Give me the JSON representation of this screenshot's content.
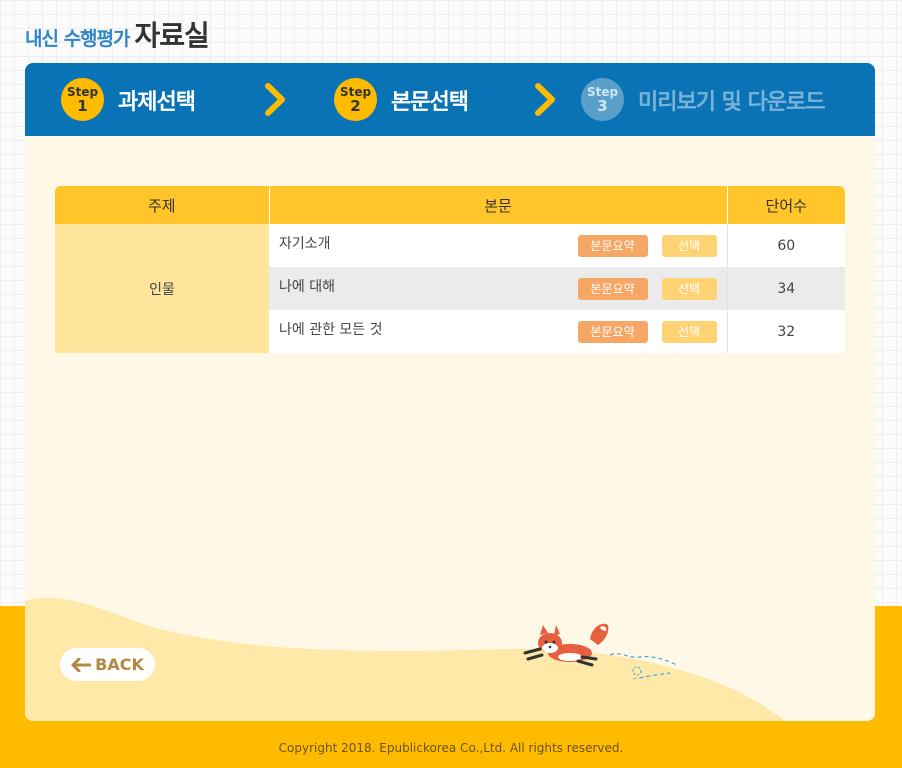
{
  "header": {
    "sub_title": "내신 수행평가",
    "main_title": "자료실"
  },
  "steps": [
    {
      "word": "Step",
      "number": "1",
      "label": "과제선택",
      "state": "done"
    },
    {
      "word": "Step",
      "number": "2",
      "label": "본문선택",
      "state": "active"
    },
    {
      "word": "Step",
      "number": "3",
      "label": "미리보기 및 다운로드",
      "state": "inactive"
    }
  ],
  "table": {
    "headers": [
      "주제",
      "본문",
      "단어수"
    ],
    "topic": "인물",
    "rows": [
      {
        "title": "자기소개",
        "summary_label": "본문요약",
        "select_label": "선택",
        "count": "60"
      },
      {
        "title": "나에 대해",
        "summary_label": "본문요약",
        "select_label": "선택",
        "count": "34"
      },
      {
        "title": "나에 관한 모든 것",
        "summary_label": "본문요약",
        "select_label": "선택",
        "count": "32"
      }
    ]
  },
  "back_button": {
    "label": "BACK"
  },
  "footer": {
    "copyright": "Copyright 2018. Epublickorea Co.,Ltd. All rights reserved."
  },
  "colors": {
    "step_bar": "#0a73b5",
    "accent_yellow": "#ffbb00",
    "header_blue": "#2f85c9",
    "summary_button": "#f6a766",
    "select_button": "#ffd374"
  },
  "icons": [
    "chevron-right-icon",
    "back-arrow-icon",
    "fox-illustration"
  ]
}
